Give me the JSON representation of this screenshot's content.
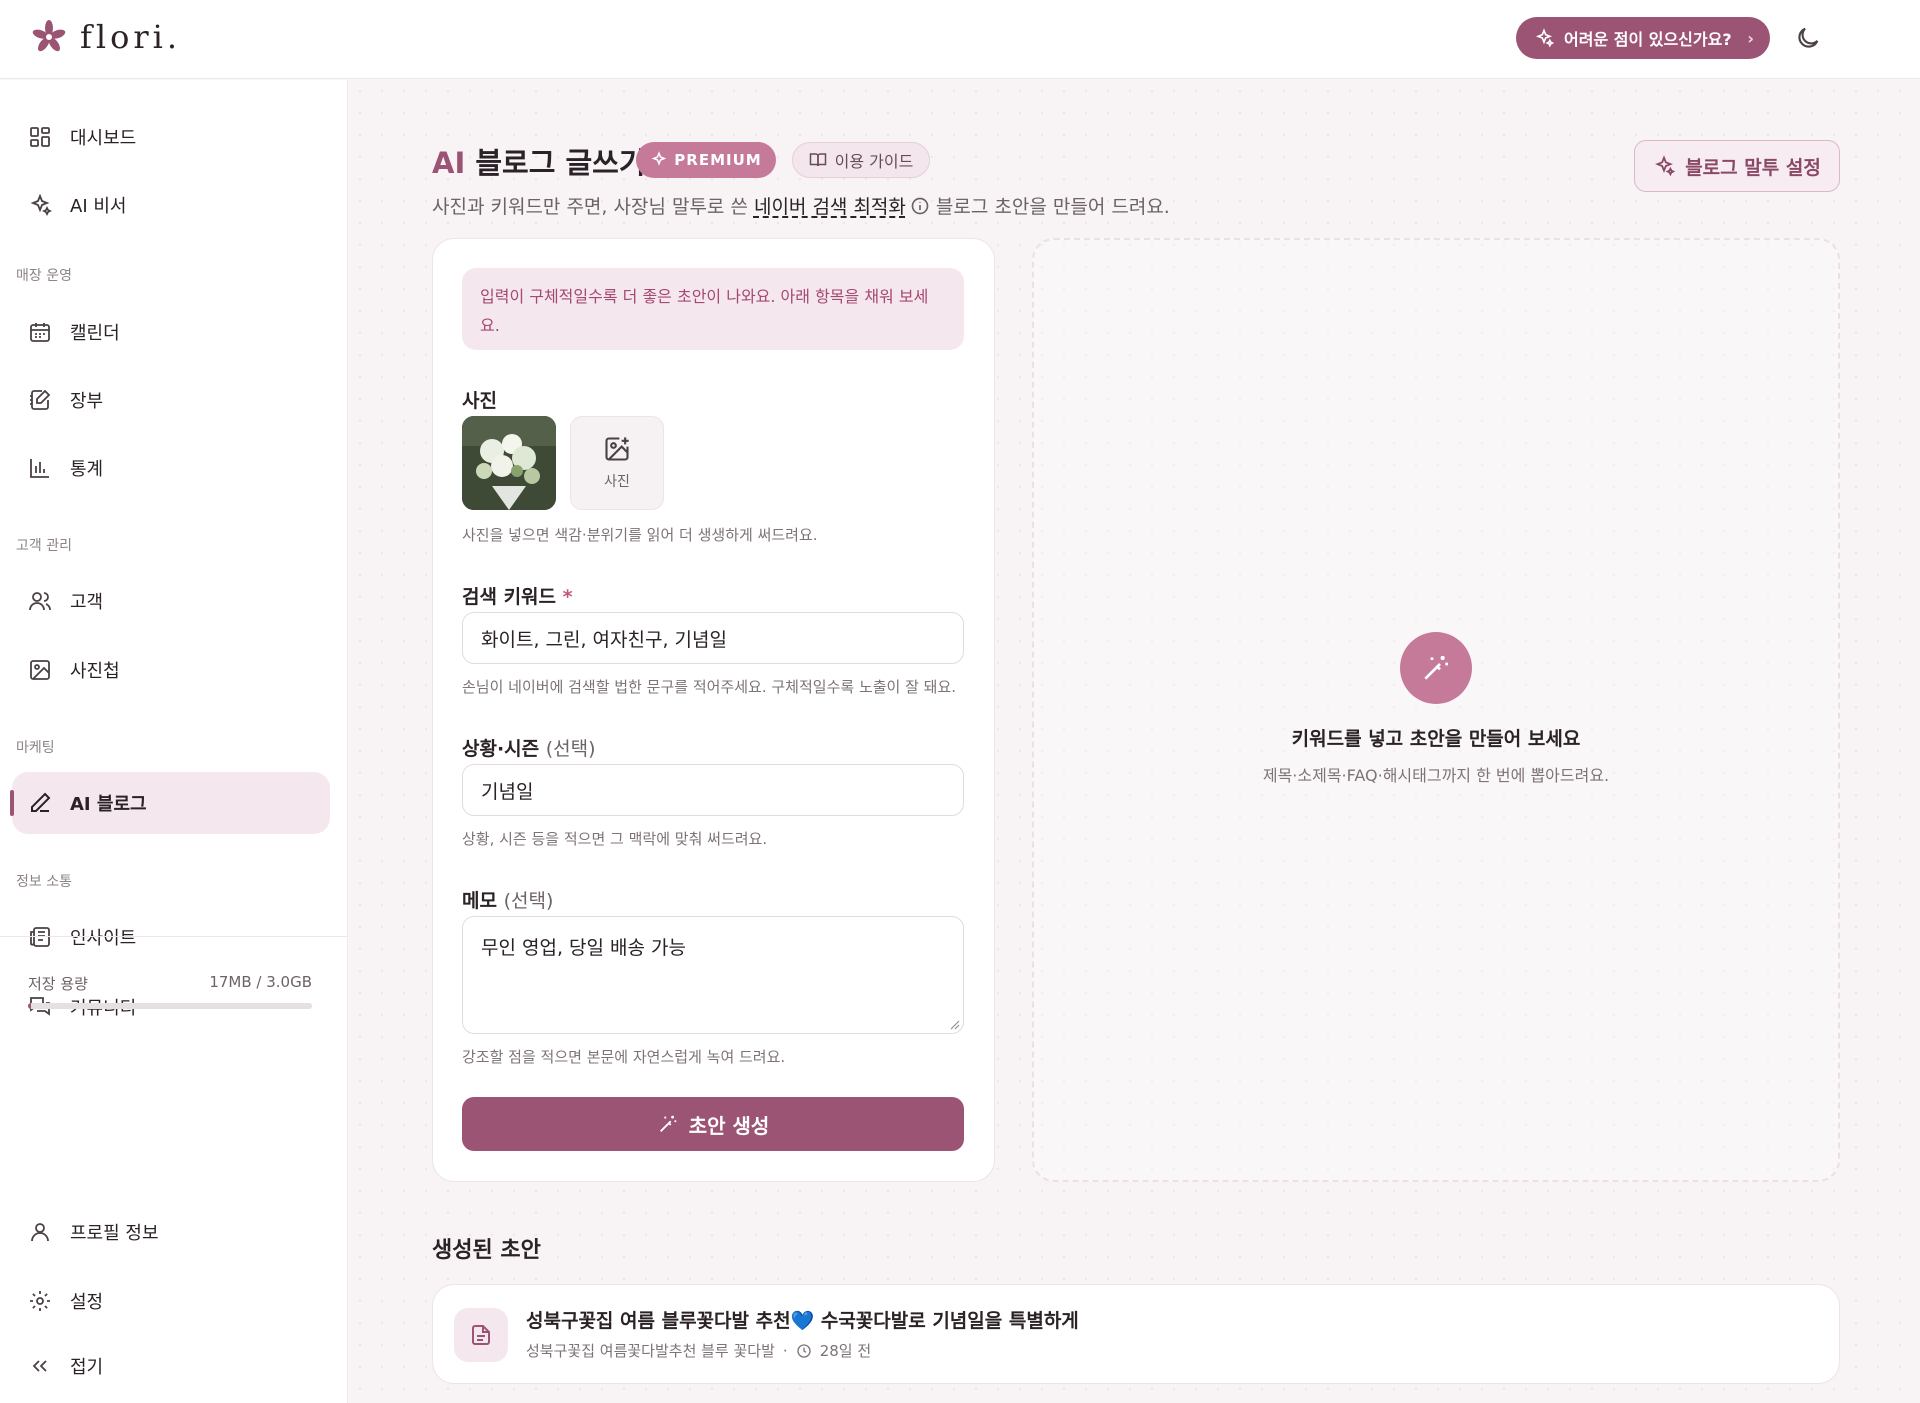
{
  "app": {
    "name": "flori."
  },
  "header": {
    "help_label": "어려운 점이 있으신가요?"
  },
  "sidebar": {
    "items": {
      "dashboard": "대시보드",
      "ai_assistant": "AI 비서",
      "calendar": "캘린더",
      "ledger": "장부",
      "stats": "통계",
      "customers": "고객",
      "album": "사진첩",
      "ai_blog": "AI 블로그",
      "insight": "인사이트",
      "community": "커뮤니티",
      "profile": "프로필 정보",
      "settings": "설정",
      "collapse": "접기"
    },
    "sections": {
      "store": "매장 운영",
      "customer": "고객 관리",
      "marketing": "마케팅",
      "info": "정보 소통"
    },
    "storage": {
      "label": "저장 용량",
      "value": "17MB / 3.0GB",
      "used_fraction": 0.006
    }
  },
  "page": {
    "title_ai": "AI",
    "title_rest": " 블로그 글쓰기",
    "premium_badge": "PREMIUM",
    "guide_label": "이용 가이드",
    "subtitle_before": "사진과 키워드만 주면, 사장님 말투로 쓴 ",
    "subtitle_link": "네이버 검색 최적화",
    "subtitle_after": " 블로그 초안을 만들어 드려요.",
    "tone_button": "블로그 말투 설정"
  },
  "form": {
    "notice": "입력이 구체적일수록 더 좋은 초안이 나와요. 아래 항목을 채워 보세요.",
    "photo_label": "사진",
    "photo_add_label": "사진",
    "photo_helper": "사진을 넣으면 색감·분위기를 읽어 더 생생하게 써드려요.",
    "keyword_label": "검색 키워드",
    "keyword_required": "*",
    "keyword_value": "화이트, 그린, 여자친구, 기념일",
    "keyword_helper": "손님이 네이버에 검색할 법한 문구를 적어주세요. 구체적일수록 노출이 잘 돼요.",
    "season_label": "상황·시즌",
    "season_optional": "(선택)",
    "season_value": "기념일",
    "season_helper": "상황, 시즌 등을 적으면 그 맥락에 맞춰 써드려요.",
    "memo_label": "메모",
    "memo_optional": "(선택)",
    "memo_value": "무인 영업, 당일 배송 가능",
    "memo_helper": "강조할 점을 적으면 본문에 자연스럽게 녹여 드려요.",
    "generate_label": "초안 생성"
  },
  "preview": {
    "title": "키워드를 넣고 초안을 만들어 보세요",
    "subtitle": "제목·소제목·FAQ·해시태그까지 한 번에 뽑아드려요."
  },
  "drafts": {
    "title": "생성된 초안",
    "items": [
      {
        "title": "성북구꽃집 여름 블루꽃다발 추천💙 수국꽃다발로 기념일을 특별하게",
        "tags": "성북구꽃집 여름꽃다발추천 블루 꽃다발",
        "time": "28일 전"
      }
    ]
  },
  "colors": {
    "accent": "#9c5474",
    "accent_light": "#c67a9a",
    "bg": "#f8f3f5"
  }
}
